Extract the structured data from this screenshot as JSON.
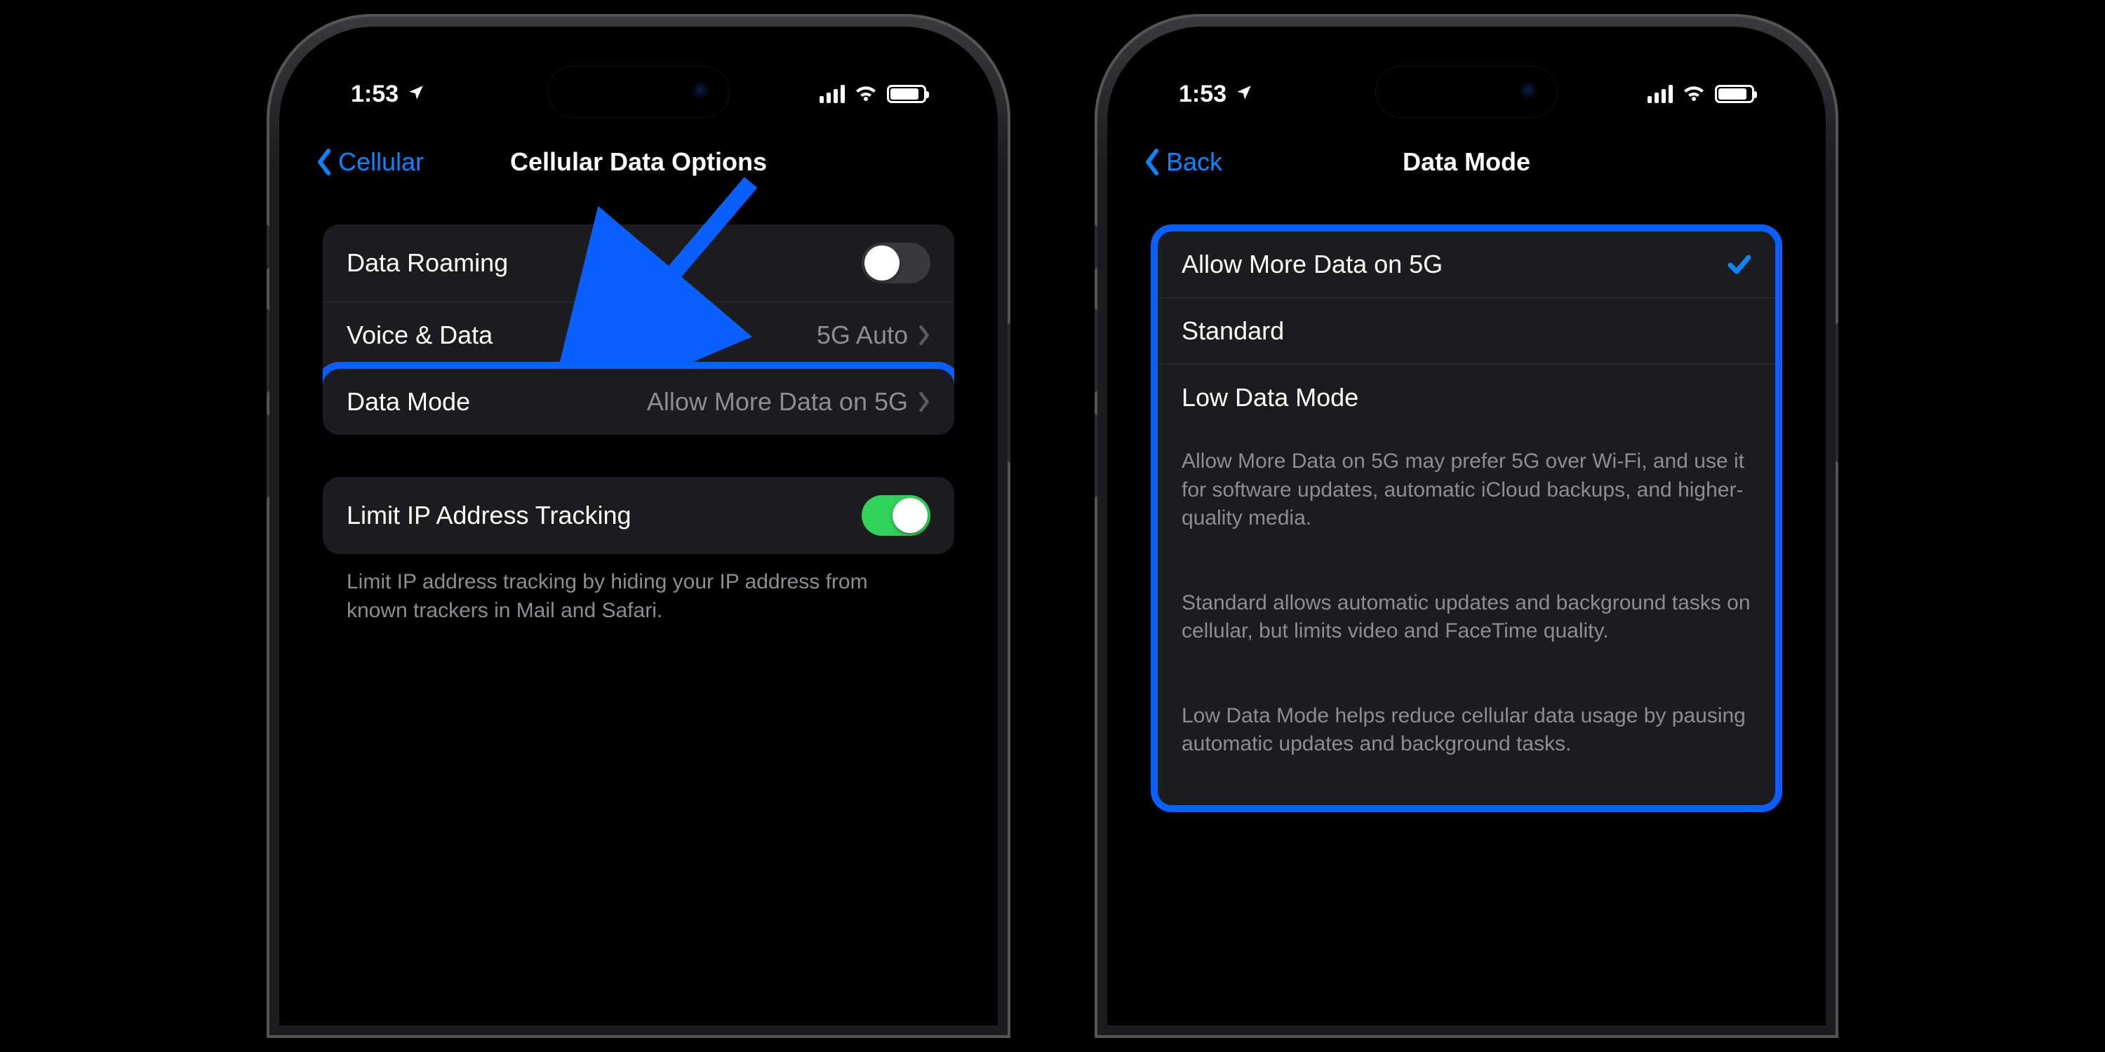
{
  "status_time": "1:53",
  "colors": {
    "accent": "#0a84ff",
    "highlight": "#0a5fff",
    "toggle_on": "#30d158"
  },
  "phone_left": {
    "nav_back": "Cellular",
    "nav_title": "Cellular Data Options",
    "rows": {
      "data_roaming": {
        "label": "Data Roaming",
        "on": false
      },
      "voice_data": {
        "label": "Voice & Data",
        "value": "5G Auto"
      },
      "data_mode": {
        "label": "Data Mode",
        "value": "Allow More Data on 5G"
      },
      "limit_ip": {
        "label": "Limit IP Address Tracking",
        "on": true
      }
    },
    "footer": "Limit IP address tracking by hiding your IP address from known trackers in Mail and Safari."
  },
  "phone_right": {
    "nav_back": "Back",
    "nav_title": "Data Mode",
    "options": [
      {
        "label": "Allow More Data on 5G",
        "selected": true
      },
      {
        "label": "Standard",
        "selected": false
      },
      {
        "label": "Low Data Mode",
        "selected": false
      }
    ],
    "footer_1": "Allow More Data on 5G may prefer 5G over Wi-Fi, and use it for software updates, automatic iCloud backups, and higher-quality media.",
    "footer_2": "Standard allows automatic updates and background tasks on cellular, but limits video and FaceTime quality.",
    "footer_3": "Low Data Mode helps reduce cellular data usage by pausing automatic updates and background tasks."
  }
}
